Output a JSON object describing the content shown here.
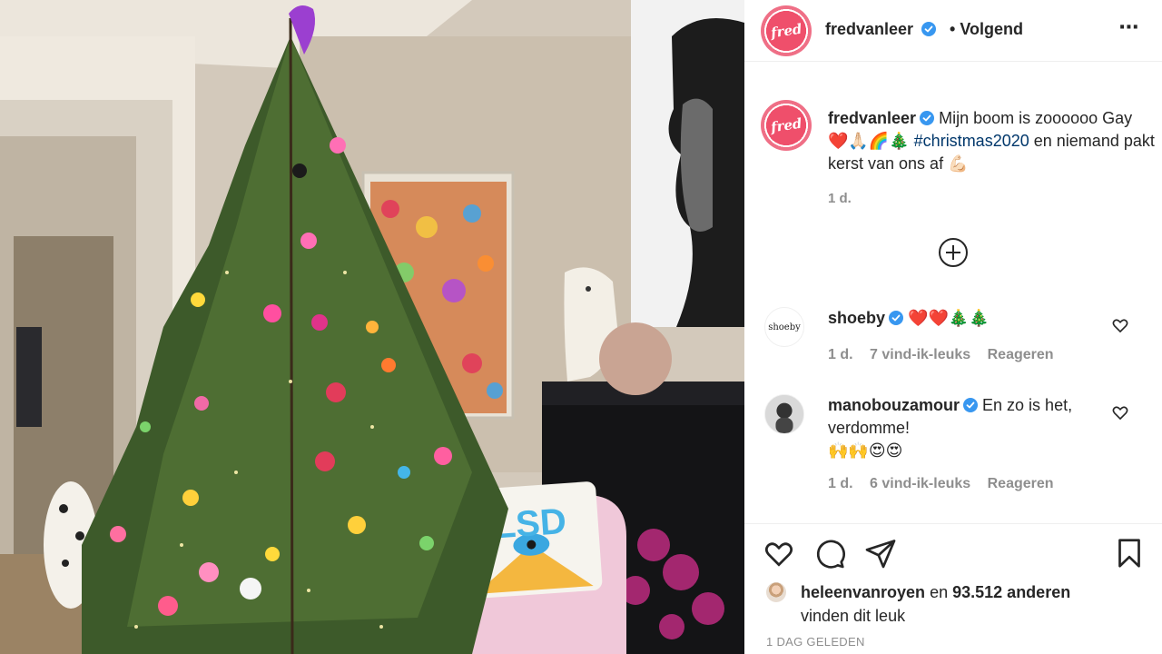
{
  "header": {
    "avatar_text": "fred",
    "username": "fredvanleer",
    "separator": "•",
    "follow_status": "Volgend",
    "more_icon": "⋯"
  },
  "caption": {
    "avatar_text": "fred",
    "username": "fredvanleer",
    "text_1": "Mijn boom is zoooooo Gay",
    "emojis_1": "❤️🙏🏻🌈🎄",
    "hashtag": "#christmas2020",
    "text_2": "en niemand pakt kerst van ons af",
    "emoji_2": "💪🏻",
    "time": "1 d."
  },
  "comments": [
    {
      "avatar_text": "shoeby",
      "username": "shoeby",
      "text": "❤️❤️🎄🎄",
      "time": "1 d.",
      "likes": "7 vind-ik-leuks",
      "reply": "Reageren"
    },
    {
      "avatar_text": "",
      "username": "manobouzamour",
      "text": "En zo is het, verdomme!",
      "emojis": "🙌🙌😍😍",
      "time": "1 d.",
      "likes": "6 vind-ik-leuks",
      "reply": "Reageren"
    }
  ],
  "likes": {
    "user": "heleenvanroyen",
    "joiner": "en",
    "others": "93.512 anderen",
    "suffix": "vinden dit leuk"
  },
  "post_date": "1 DAG GELEDEN",
  "photo": {
    "pillow_text": "LSD"
  },
  "colors": {
    "text": "#262626",
    "muted": "#8e8e8e",
    "verified": "#3897f0",
    "hashtag": "#00376b",
    "divider": "#efefef"
  }
}
